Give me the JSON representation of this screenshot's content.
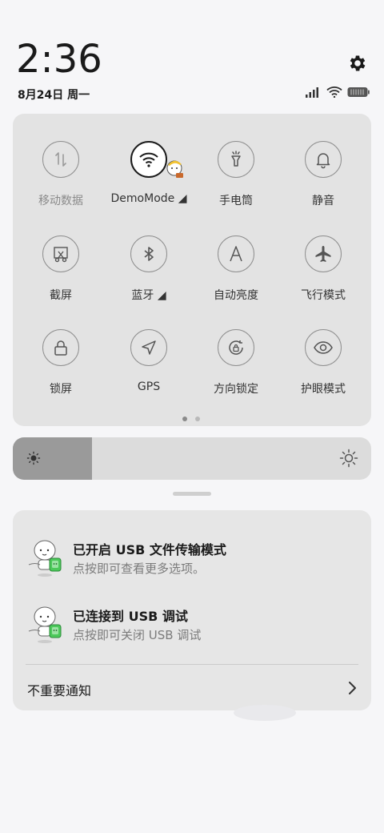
{
  "status": {
    "time": "2:36",
    "date": "8月24日 周一",
    "icons": [
      "signal-icon",
      "wifi-icon",
      "battery-icon"
    ]
  },
  "quick_settings": {
    "tiles": [
      {
        "label": "移动数据",
        "icon": "mobile-data-icon",
        "active": false,
        "dim": true
      },
      {
        "label": "DemoMode ◢",
        "icon": "wifi-icon",
        "active": true
      },
      {
        "label": "手电筒",
        "icon": "flashlight-icon",
        "active": false
      },
      {
        "label": "静音",
        "icon": "bell-icon",
        "active": false
      },
      {
        "label": "截屏",
        "icon": "screenshot-scissors-icon",
        "active": false
      },
      {
        "label": "蓝牙 ◢",
        "icon": "bluetooth-icon",
        "active": false
      },
      {
        "label": "自动亮度",
        "icon": "auto-brightness-icon",
        "active": false
      },
      {
        "label": "飞行模式",
        "icon": "airplane-icon",
        "active": false
      },
      {
        "label": "锁屏",
        "icon": "lock-icon",
        "active": false
      },
      {
        "label": "GPS",
        "icon": "location-arrow-icon",
        "active": false
      },
      {
        "label": "方向锁定",
        "icon": "rotation-lock-icon",
        "active": false
      },
      {
        "label": "护眼模式",
        "icon": "eye-icon",
        "active": false
      }
    ],
    "page_count": 2,
    "current_page": 1
  },
  "brightness": {
    "level": 0.22
  },
  "notifications": [
    {
      "title": "已开启 USB 文件传输模式",
      "text": "点按即可查看更多选项。"
    },
    {
      "title": "已连接到 USB 调试",
      "text": "点按即可关闭 USB 调试"
    }
  ],
  "unimportant_label": "不重要通知",
  "colors": {
    "panel": "#e3e3e3",
    "accent_green": "#4cc95a",
    "icon_gray": "#8f8f8f"
  }
}
